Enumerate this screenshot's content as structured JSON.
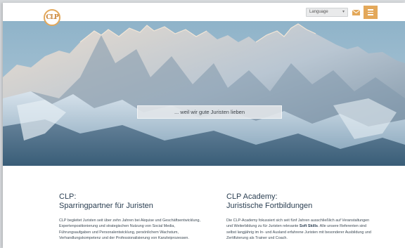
{
  "header": {
    "logo_text": "CLP",
    "language_label": "Language",
    "mail_icon": "mail-icon",
    "menu_icon": "hamburger-menu-icon",
    "accent_color": "#e3a85a"
  },
  "hero": {
    "tagline": "... weil wir gute Juristen lieben"
  },
  "sections": [
    {
      "title_line1": "CLP:",
      "title_line2": "Sparringpartner für Juristen",
      "body": "CLP begleitet Juristen seit über zehn Jahren bei Akquise und Geschäftsentwicklung, Expertenpositionierung und strategischen Nutzung von Social Media, Führungsaufgaben und Personalentwicklung, persönlichem Wachstum, Verhandlungskompetenz und der Professionalisierung von Kanzleiprozessen."
    },
    {
      "title_line1": "CLP Academy:",
      "title_line2": "Juristische Fortbildungen",
      "body_before": "Die CLP-Academy fokussiert sich seit fünf Jahren ausschließlich auf Veranstaltungen und Weiterbildung zu für Juristen relevante ",
      "body_bold": "Soft Skills",
      "body_after": ". Alle unsere Referenten sind selbst langjährig im In- und Ausland erfahrene Juristen mit besonderer Ausbildung und Zertifizierung als Trainer und Coach."
    }
  ]
}
